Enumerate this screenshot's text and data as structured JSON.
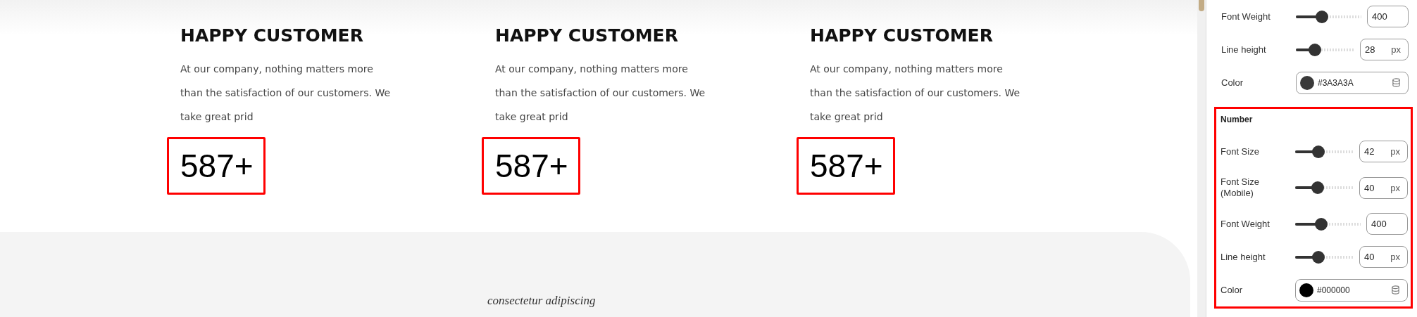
{
  "stats": [
    {
      "title": "HAPPY CUSTOMER",
      "text": "At our company, nothing matters more than the satisfaction of our customers. We take great prid",
      "number": "587+",
      "highlighted": true
    },
    {
      "title": "HAPPY CUSTOMER",
      "text": "At our company, nothing matters more than the satisfaction of our customers. We take great prid",
      "number": "587+",
      "highlighted": true
    },
    {
      "title": "HAPPY CUSTOMER",
      "text": "At our company, nothing matters more than the satisfaction of our customers. We take great prid",
      "number": "587+",
      "highlighted": true
    }
  ],
  "footer_text": "consectetur adipiscing",
  "settings": {
    "rows": [
      {
        "kind": "number",
        "label": "Font Weight",
        "level": 0.4,
        "value": "400"
      },
      {
        "kind": "unit",
        "label": "Line height",
        "level": 0.33,
        "value": "28",
        "unit": "px"
      },
      {
        "kind": "color",
        "label": "Color",
        "value": "#3A3A3A",
        "color": "#3a3a3a"
      }
    ],
    "number_section": {
      "title": "Number",
      "highlighted": true,
      "rows": [
        {
          "kind": "unit",
          "label": "Font Size",
          "level": 0.4,
          "value": "42",
          "unit": "px"
        },
        {
          "kind": "unit",
          "label": "Font Size (Mobile)",
          "level": 0.39,
          "value": "40",
          "unit": "px"
        },
        {
          "kind": "number",
          "label": "Font Weight",
          "level": 0.4,
          "value": "400"
        },
        {
          "kind": "unit",
          "label": "Line height",
          "level": 0.4,
          "value": "40",
          "unit": "px"
        },
        {
          "kind": "color",
          "label": "Color",
          "value": "#000000",
          "color": "#000000"
        }
      ]
    }
  }
}
